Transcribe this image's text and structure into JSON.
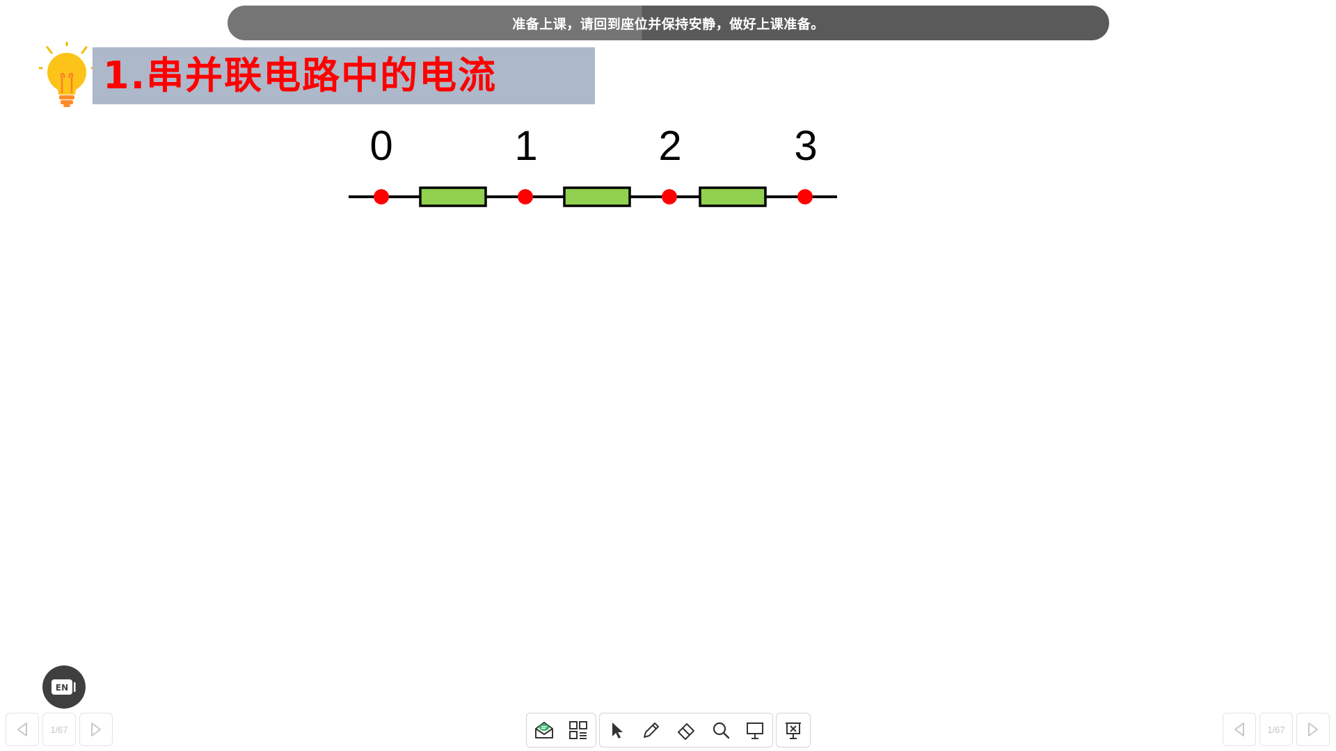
{
  "notice": {
    "text": "准备上课，请回到座位并保持安静，做好上课准备。"
  },
  "slide": {
    "title": "1.串并联电路中的电流",
    "circuit": {
      "node_labels": [
        "0",
        "1",
        "2",
        "3"
      ],
      "node_color": "#ff0000",
      "resistor_color": "#92d050"
    }
  },
  "language_button": {
    "label": "EN"
  },
  "pager_left": {
    "page": "1/67"
  },
  "pager_right": {
    "page": "1/67"
  },
  "toolbar": {
    "tools": [
      {
        "name": "message-icon"
      },
      {
        "name": "apps-grid-icon"
      },
      {
        "name": "pointer-icon"
      },
      {
        "name": "pen-icon"
      },
      {
        "name": "eraser-icon"
      },
      {
        "name": "magnifier-icon"
      },
      {
        "name": "whiteboard-icon"
      },
      {
        "name": "exit-presentation-icon"
      }
    ]
  },
  "colors": {
    "title_text": "#ff0000",
    "title_background": "#adb9ca",
    "notice_bar": "#5a5a5a"
  }
}
